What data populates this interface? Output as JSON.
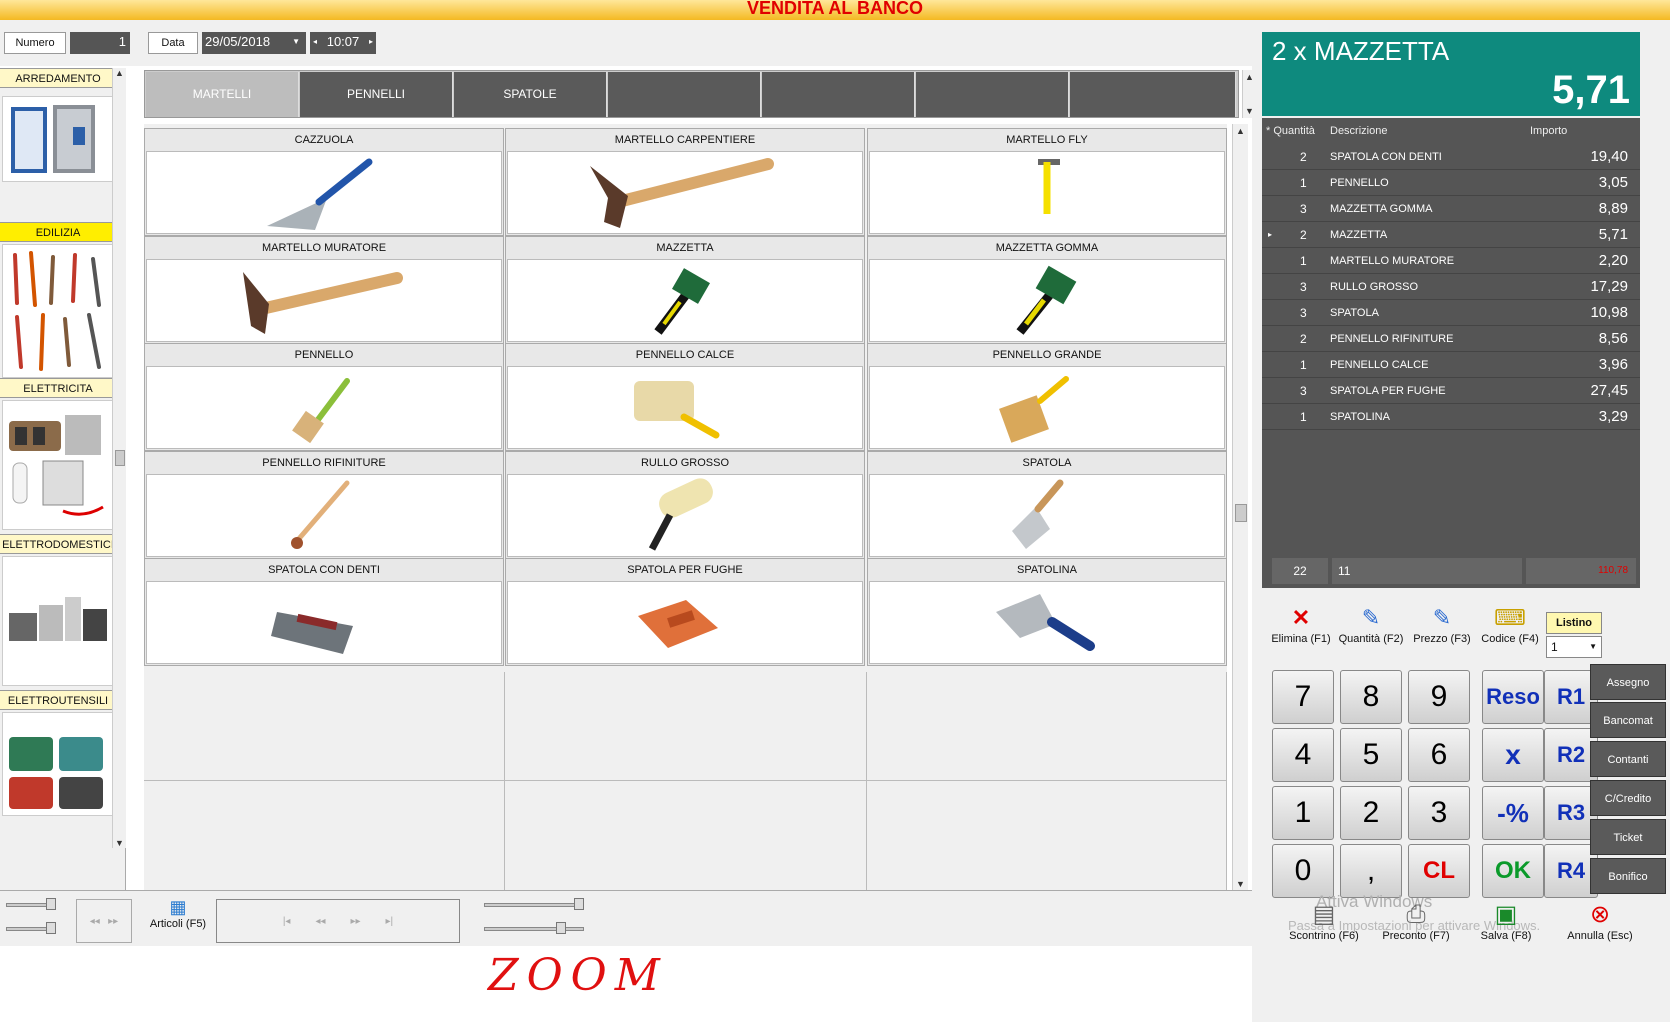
{
  "title": "VENDITA AL BANCO",
  "header": {
    "numero_label": "Numero",
    "numero_value": "1",
    "data_label": "Data",
    "data_value": "29/05/2018",
    "time_value": "10:07"
  },
  "categories": [
    {
      "label": "ARREDAMENTO",
      "selected": false
    },
    {
      "label": "EDILIZIA",
      "selected": true
    },
    {
      "label": "ELETTRICITA",
      "selected": false
    },
    {
      "label": "ELETTRODOMESTICI",
      "selected": false
    },
    {
      "label": "ELETTROUTENSILI",
      "selected": false
    }
  ],
  "tabs": [
    {
      "label": "MARTELLI",
      "selected": true
    },
    {
      "label": "PENNELLI",
      "selected": false
    },
    {
      "label": "SPATOLE",
      "selected": false
    },
    {
      "label": ""
    },
    {
      "label": ""
    },
    {
      "label": ""
    },
    {
      "label": ""
    }
  ],
  "products": [
    {
      "label": "CAZZUOLA",
      "icon": "trowel-icon"
    },
    {
      "label": "MARTELLO CARPENTIERE",
      "icon": "hammer-icon"
    },
    {
      "label": "MARTELLO FLY",
      "icon": "pick-hammer-icon"
    },
    {
      "label": "MARTELLO MURATORE",
      "icon": "hammer-icon"
    },
    {
      "label": "MAZZETTA",
      "icon": "mallet-icon"
    },
    {
      "label": "MAZZETTA GOMMA",
      "icon": "mallet-icon"
    },
    {
      "label": "PENNELLO",
      "icon": "brush-icon"
    },
    {
      "label": "PENNELLO CALCE",
      "icon": "wide-brush-icon"
    },
    {
      "label": "PENNELLO GRANDE",
      "icon": "wide-brush-icon"
    },
    {
      "label": "PENNELLO RIFINITURE",
      "icon": "thin-brush-icon"
    },
    {
      "label": "RULLO GROSSO",
      "icon": "roller-icon"
    },
    {
      "label": "SPATOLA",
      "icon": "spatula-icon"
    },
    {
      "label": "SPATOLA CON DENTI",
      "icon": "notched-trowel-icon"
    },
    {
      "label": "SPATOLA PER FUGHE",
      "icon": "grout-float-icon"
    },
    {
      "label": "SPATOLINA",
      "icon": "putty-knife-icon"
    }
  ],
  "display": {
    "title": "2 x MAZZETTA",
    "total": "5,71"
  },
  "receipt": {
    "headers": {
      "qty": "Quantità",
      "desc": "Descrizione",
      "amount": "Importo"
    },
    "rows": [
      {
        "qty": "2",
        "desc": "SPATOLA CON DENTI",
        "amount": "19,40"
      },
      {
        "qty": "1",
        "desc": "PENNELLO",
        "amount": "3,05"
      },
      {
        "qty": "3",
        "desc": "MAZZETTA GOMMA",
        "amount": "8,89"
      },
      {
        "qty": "2",
        "desc": "MAZZETTA",
        "amount": "5,71"
      },
      {
        "qty": "1",
        "desc": "MARTELLO MURATORE",
        "amount": "2,20"
      },
      {
        "qty": "3",
        "desc": "RULLO GROSSO",
        "amount": "17,29"
      },
      {
        "qty": "3",
        "desc": "SPATOLA",
        "amount": "10,98"
      },
      {
        "qty": "2",
        "desc": "PENNELLO RIFINITURE",
        "amount": "8,56"
      },
      {
        "qty": "1",
        "desc": "PENNELLO CALCE",
        "amount": "3,96"
      },
      {
        "qty": "3",
        "desc": "SPATOLA PER FUGHE",
        "amount": "27,45"
      },
      {
        "qty": "1",
        "desc": "SPATOLINA",
        "amount": "3,29"
      }
    ],
    "footer": {
      "qty_total": "22",
      "count": "11",
      "amount_total": "110,78"
    }
  },
  "tools": {
    "elimina": "Elimina (F1)",
    "quantita": "Quantità (F2)",
    "prezzo": "Prezzo (F3)",
    "codice": "Codice (F4)",
    "listino_label": "Listino",
    "listino_value": "1"
  },
  "keypad": [
    "7",
    "8",
    "9",
    "4",
    "5",
    "6",
    "1",
    "2",
    "3",
    "0",
    ",",
    "CL"
  ],
  "ops": [
    "Reso",
    "x",
    "-%",
    "OK"
  ],
  "r_keys": [
    "R1",
    "R2",
    "R3",
    "R4"
  ],
  "payments": [
    "Assegno",
    "Bancomat",
    "Contanti",
    "C/Credito",
    "Ticket",
    "Bonifico"
  ],
  "bottom": {
    "articoli": "Articoli (F5)",
    "scontrino": "Scontrino (F6)",
    "preconto": "Preconto (F7)",
    "salva": "Salva (F8)",
    "annulla": "Annulla (Esc)"
  },
  "watermark": {
    "line1": "Attiva Windows",
    "line2": "Passa a Impostazioni per attivare Windows."
  },
  "annotation": "ZOOM",
  "colors": {
    "accent": "#0e8a7e",
    "title": "#e00000",
    "receipt_bg": "#555555",
    "total_red": "#e00000"
  }
}
